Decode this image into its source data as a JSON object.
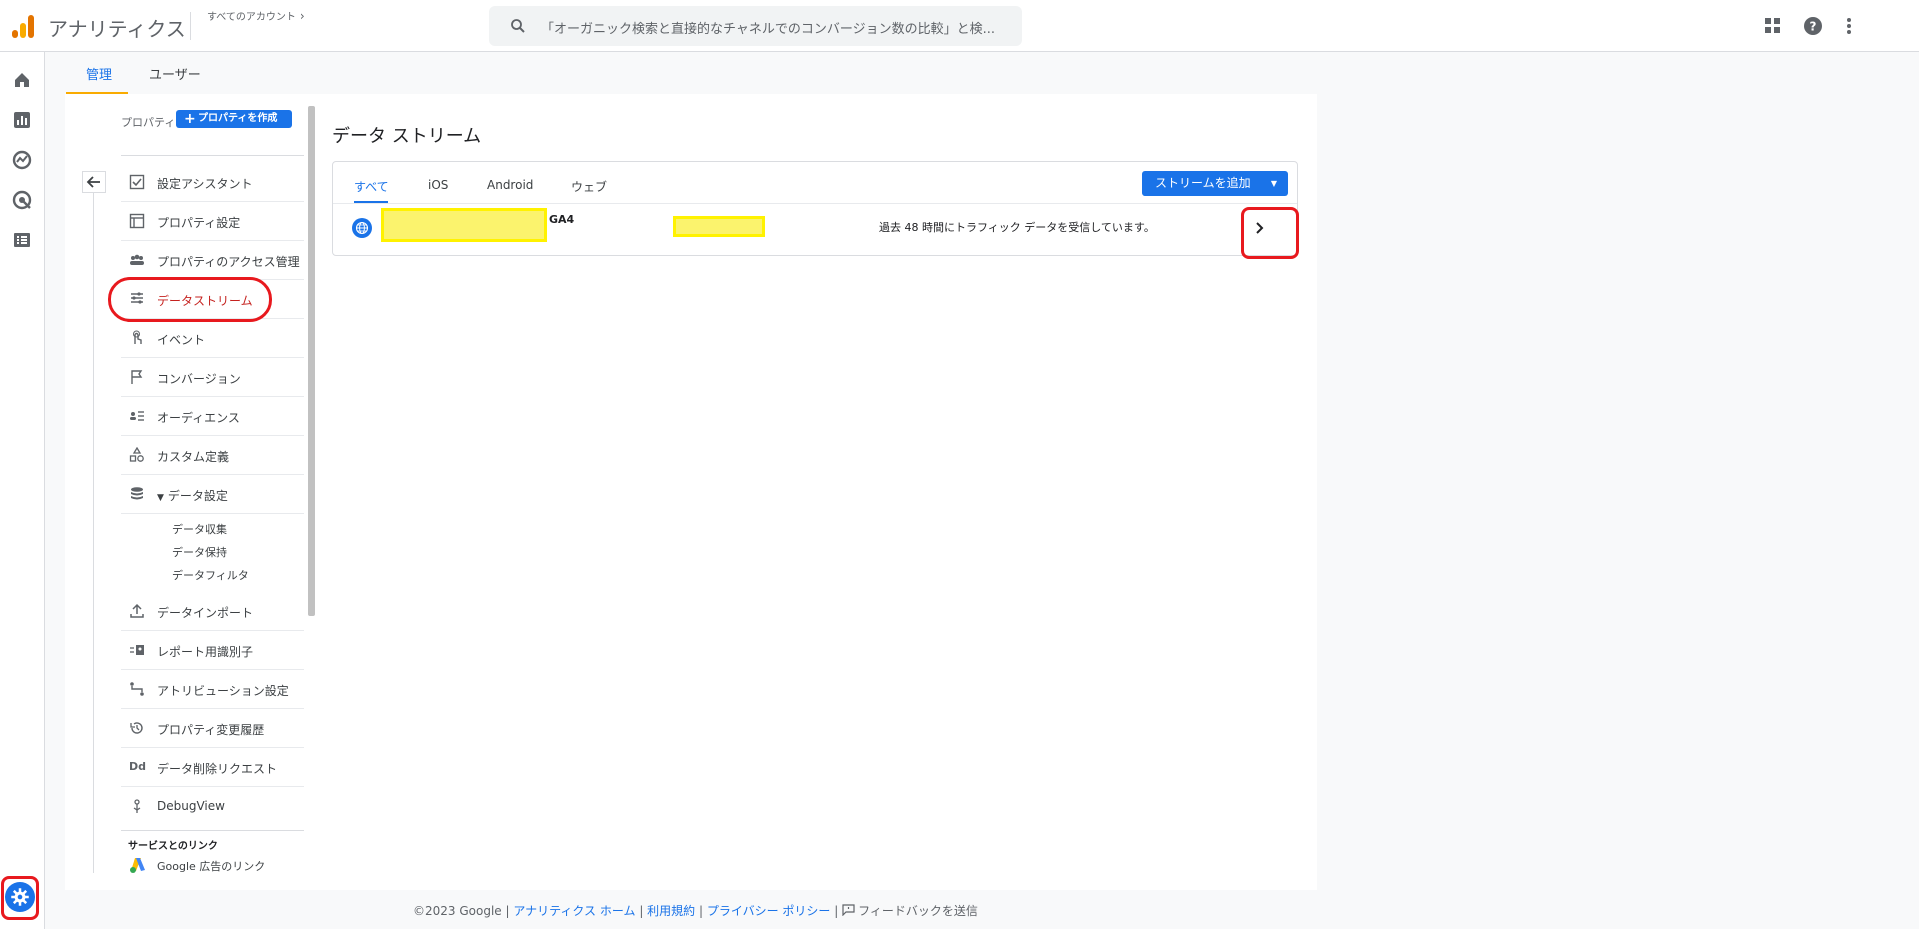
{
  "app": {
    "title": "アナリティクス",
    "account_crumb": "すべてのアカウント",
    "search_placeholder": "「オーガニック検索と直接的なチャネルでのコンバージョン数の比較」と検..."
  },
  "icons": {
    "apps": "apps-grid-icon",
    "help": "help-circle-icon",
    "more": "more-vert-icon",
    "rail": [
      "home-icon",
      "reports-icon",
      "explore-icon",
      "advertising-icon",
      "configure-icon"
    ],
    "admin": "gear-icon"
  },
  "colors": {
    "accent": "#1a73e8",
    "active_nav": "#c5221f",
    "annotation_red": "#e8191e",
    "highlight_yellow": "#fff200",
    "logo_orange": "#e37400"
  },
  "admin_tabs": [
    "管理",
    "ユーザー"
  ],
  "nav": {
    "property_label": "プロパティ",
    "create_property": "プロパティを作成",
    "items": [
      {
        "label": "設定アシスタント",
        "icon": "checklist-icon"
      },
      {
        "label": "プロパティ設定",
        "icon": "property-settings-icon"
      },
      {
        "label": "プロパティのアクセス管理",
        "icon": "people-icon"
      },
      {
        "label": "データストリーム",
        "icon": "data-stream-icon"
      },
      {
        "label": "イベント",
        "icon": "touch-icon"
      },
      {
        "label": "コンバージョン",
        "icon": "flag-icon"
      },
      {
        "label": "オーディエンス",
        "icon": "audience-icon"
      },
      {
        "label": "カスタム定義",
        "icon": "shapes-icon"
      },
      {
        "label": "データ設定",
        "icon": "database-icon"
      }
    ],
    "sub_items": [
      "データ収集",
      "データ保持",
      "データフィルタ"
    ],
    "items_after": [
      {
        "label": "データインポート",
        "icon": "upload-icon"
      },
      {
        "label": "レポート用識別子",
        "icon": "identity-icon"
      },
      {
        "label": "アトリビューション設定",
        "icon": "attribution-icon"
      },
      {
        "label": "プロパティ変更履歴",
        "icon": "history-icon"
      },
      {
        "label": "データ削除リクエスト",
        "icon": "dd-icon"
      },
      {
        "label": "DebugView",
        "icon": "debug-icon"
      }
    ],
    "links_section": "サービスとのリンク",
    "google_ads_link": "Google 広告のリンク"
  },
  "content": {
    "title": "データ ストリーム",
    "tabs": [
      "すべて",
      "iOS",
      "Android",
      "ウェブ"
    ],
    "add_stream": "ストリームを追加",
    "stream": {
      "suffix": "GA4",
      "status": "過去 48 時間にトラフィック データを受信しています。"
    }
  },
  "footer": {
    "copyright": "©2023 Google |",
    "home": "アナリティクス ホーム",
    "sep1": " | ",
    "terms": "利用規約",
    "sep2": " | ",
    "privacy": "プライバシー ポリシー",
    "sep3": " | ",
    "feedback": "フィードバックを送信"
  }
}
